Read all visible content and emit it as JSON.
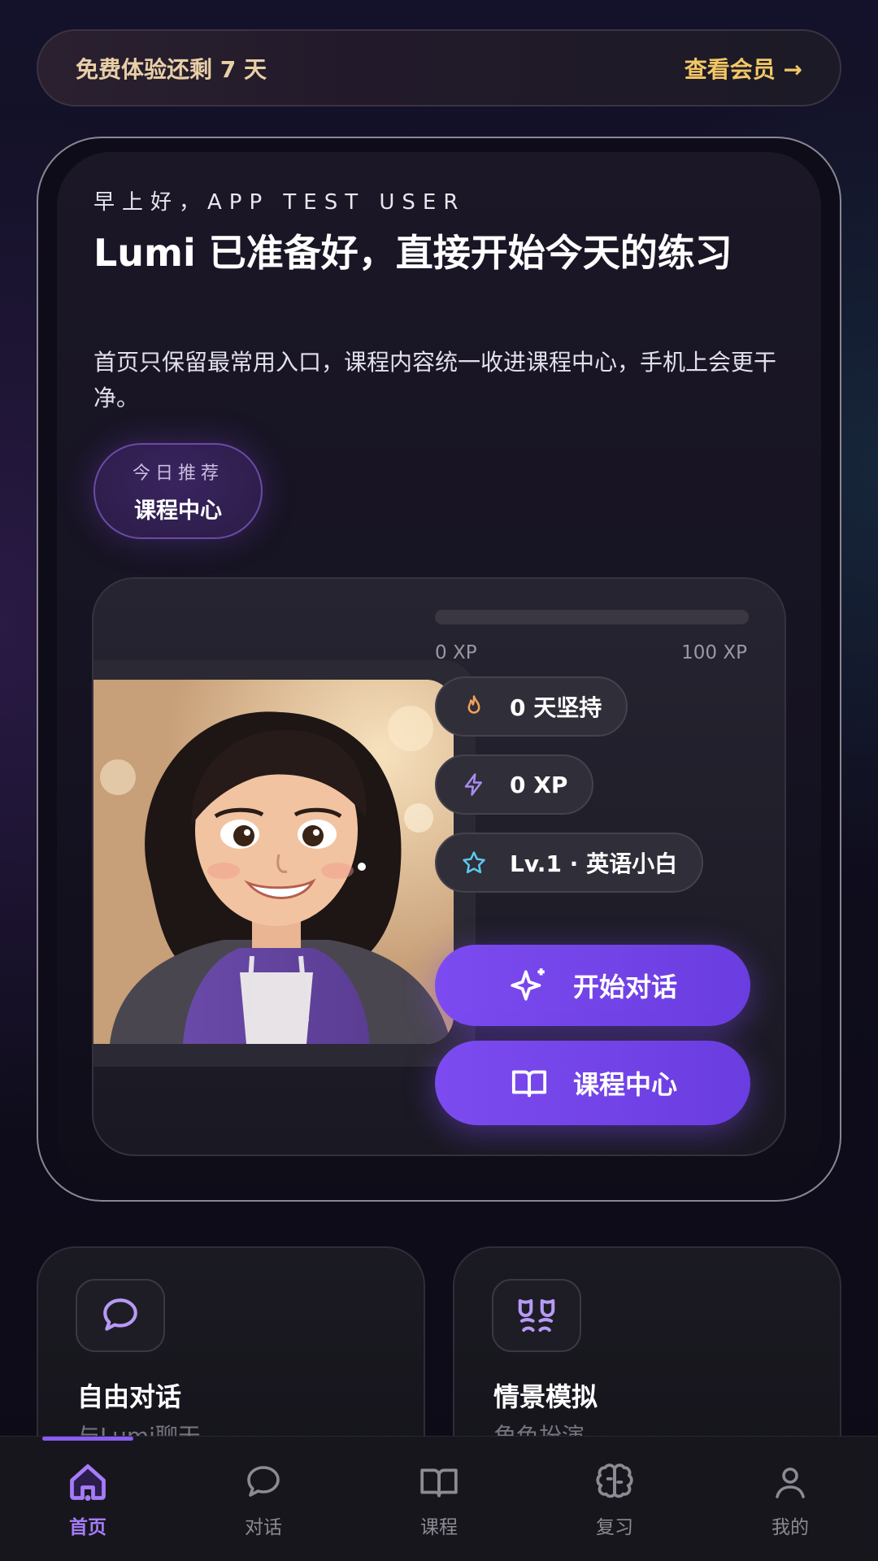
{
  "trial_banner": {
    "text": "免费体验还剩 7 天",
    "link": "查看会员 →"
  },
  "hero": {
    "greeting": "早上好，APP TEST USER",
    "headline": "Lumi 已准备好，直接开始今天的练习",
    "description": "首页只保留最常用入口，课程内容统一收进课程中心，手机上会更干净。",
    "recommend": {
      "label": "今日推荐",
      "value": "课程中心"
    }
  },
  "progress": {
    "current_label": "0 XP",
    "max_label": "100 XP",
    "fraction": 0.0
  },
  "stats": {
    "streak": "0 天坚持",
    "xp": "0 XP",
    "level": "Lv.1 · 英语小白"
  },
  "actions": {
    "start_chat": "开始对话",
    "course_center": "课程中心"
  },
  "features": [
    {
      "title": "自由对话",
      "subtitle": "与Lumi聊天",
      "icon": "chat-bubble-icon"
    },
    {
      "title": "情景模拟",
      "subtitle": "角色扮演",
      "icon": "theater-masks-icon"
    }
  ],
  "nav": {
    "items": [
      {
        "label": "首页",
        "icon": "home-icon",
        "active": true
      },
      {
        "label": "对话",
        "icon": "chat-bubble-icon"
      },
      {
        "label": "课程",
        "icon": "book-icon"
      },
      {
        "label": "复习",
        "icon": "brain-icon"
      },
      {
        "label": "我的",
        "icon": "user-icon"
      }
    ]
  },
  "colors": {
    "accent": "#8b5cf6",
    "gold": "#f3c766",
    "flame": "#f0a35a",
    "star": "#5cc8f0"
  }
}
